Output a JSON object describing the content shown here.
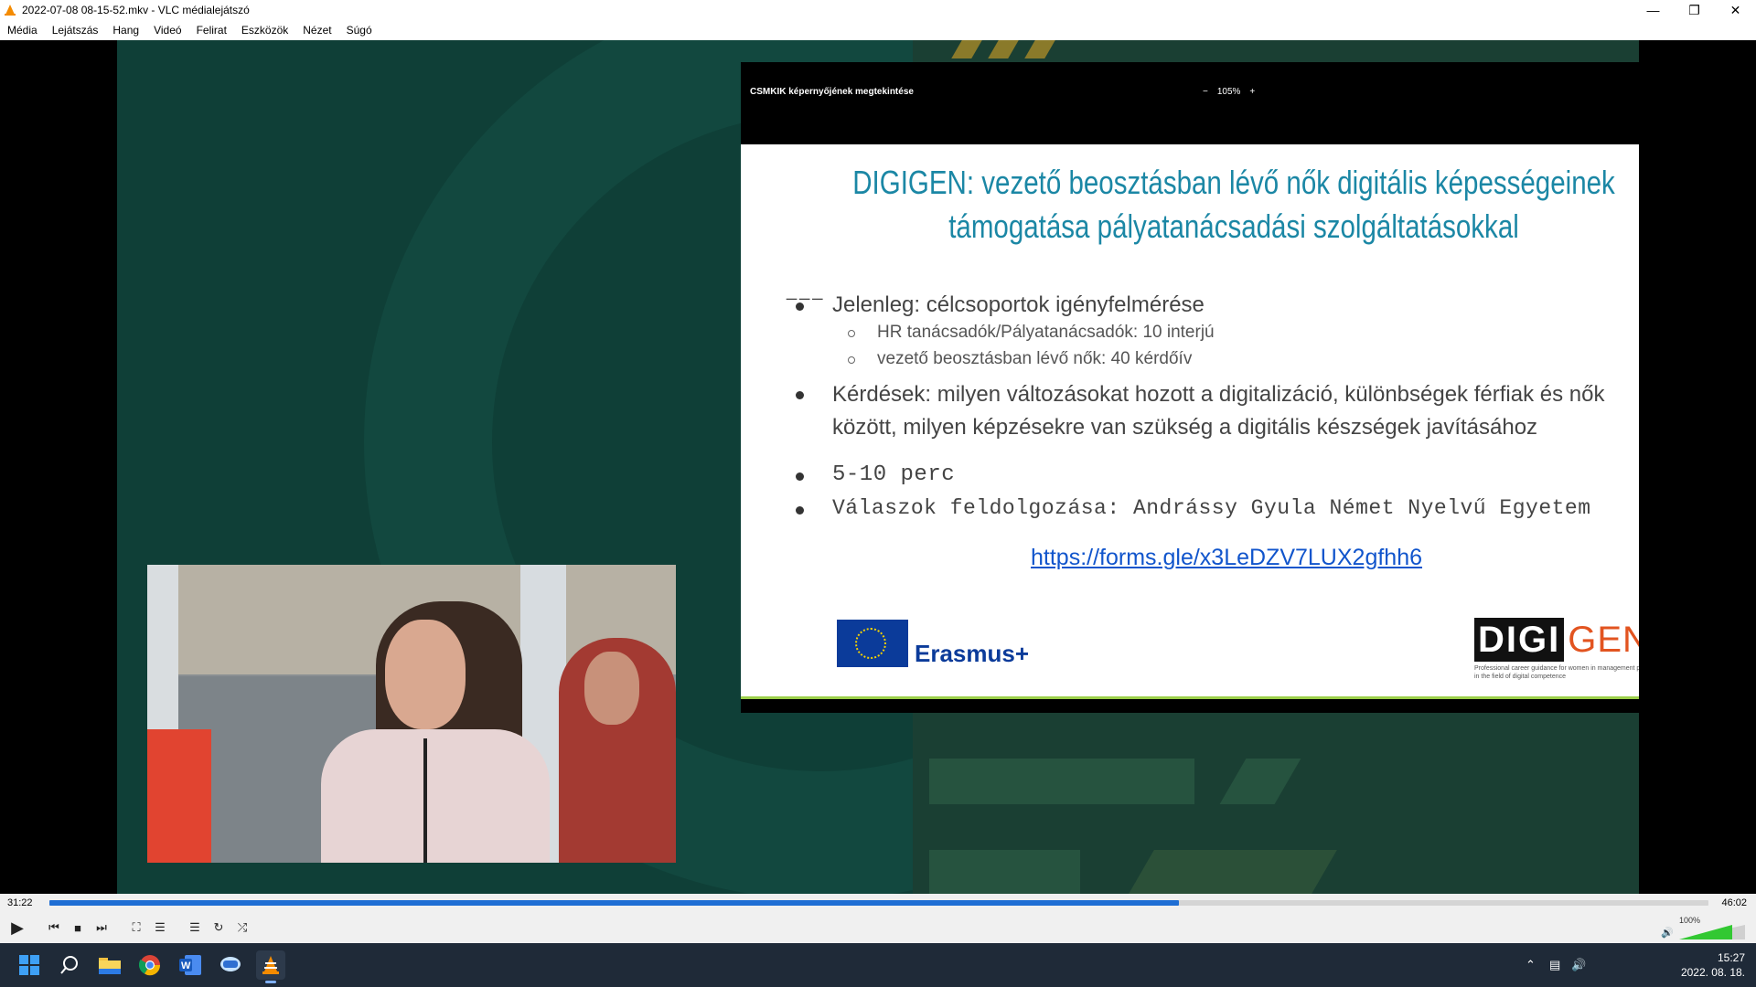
{
  "window": {
    "title": "2022-07-08 08-15-52.mkv - VLC médialejátszó"
  },
  "menu": [
    "Média",
    "Lejátszás",
    "Hang",
    "Videó",
    "Felirat",
    "Eszközök",
    "Nézet",
    "Súgó"
  ],
  "share": {
    "title": "CSMKIK képernyőjének megtekintése",
    "zoom": "105%",
    "zoom_minus": "−",
    "zoom_plus": "+"
  },
  "slide": {
    "title": "DIGIGEN: vezető beosztásban lévő nők digitális képességeinek támogatása pályatanácsadási szolgáltatásokkal",
    "separator": "___",
    "bullet1": "Jelenleg: célcsoportok igényfelmérése",
    "sub1": "HR tanácsadók/Pályatanácsadók: 10 interjú",
    "sub2": "vezető beosztásban lévő nők: 40 kérdőív",
    "bullet2_line1": "Kérdések: milyen változásokat hozott a digitalizáció, különbségek férfiak és nők",
    "bullet2_line2": "között, milyen képzésekre van szükség a digitális készségek javításához",
    "bullet3": "5-10 perc",
    "bullet4": "Válaszok feldolgozása: Andrássy Gyula Német Nyelvű Egyetem",
    "link": "https://forms.gle/x3LeDZV7LUX2gfhh6",
    "erasmus": "Erasmus+",
    "digigen_a": "DIGI",
    "digigen_b": "GEN",
    "digigen_sub": "Professional career guidance for women in management positions in the field of digital competence"
  },
  "player": {
    "elapsed": "31:22",
    "total": "46:02",
    "progress": 0.681,
    "volume": "100%"
  },
  "taskbar": {
    "time": "15:27",
    "date": "2022. 08. 18."
  }
}
